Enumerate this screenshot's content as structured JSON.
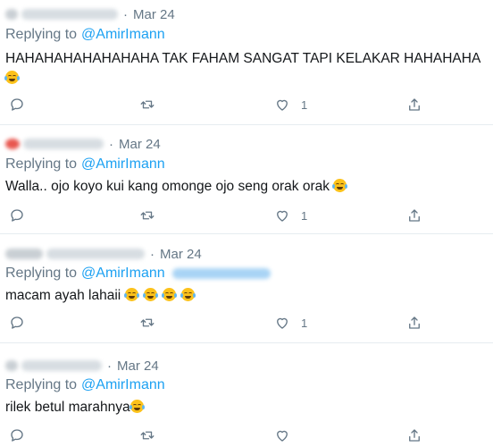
{
  "reply_prefix": "Replying to",
  "tweets": [
    {
      "date": "Mar 24",
      "reply_to": "@AmirImann",
      "text": "HAHAHAHAHAHAHAHA TAK FAHAM SANGAT TAPI KELAKAR HAHAHAHA",
      "emoji": [
        "face-with-tears-of-joy"
      ],
      "likes": "1"
    },
    {
      "date": "Mar 24",
      "reply_to": "@AmirImann",
      "text": "Walla.. ojo koyo kui kang omonge ojo seng orak orak",
      "emoji": [
        "face-with-tears-of-joy"
      ],
      "likes": "1"
    },
    {
      "date": "Mar 24",
      "reply_to": "@AmirImann",
      "text": "macam ayah lahaii",
      "emoji": [
        "loudly-crying-face",
        "loudly-crying-face",
        "face-with-tears-of-joy",
        "face-with-tears-of-joy"
      ],
      "likes": "1"
    },
    {
      "date": "Mar 24",
      "reply_to": "@AmirImann",
      "text": "rilek betul marahnya",
      "emoji": [
        "face-with-tears-of-joy"
      ],
      "likes": ""
    }
  ],
  "icons": {
    "reply": "reply-icon",
    "retweet": "retweet-icon",
    "like": "like-icon",
    "share": "share-icon"
  }
}
